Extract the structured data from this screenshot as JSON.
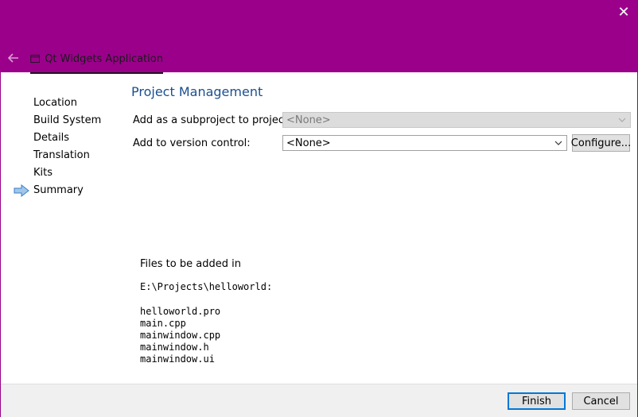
{
  "window": {
    "close_glyph": "✕",
    "header_tab_label": "Qt Widgets Application",
    "accent_color": "#9b008b"
  },
  "sidebar": {
    "steps": [
      {
        "label": "Location"
      },
      {
        "label": "Build System"
      },
      {
        "label": "Details"
      },
      {
        "label": "Translation"
      },
      {
        "label": "Kits"
      },
      {
        "label": "Summary",
        "current": true
      }
    ]
  },
  "page": {
    "title": "Project Management",
    "subproject_label": "Add as a subproject to project:",
    "subproject_value": "<None>",
    "vcs_label": "Add to version control:",
    "vcs_value": "<None>",
    "configure_label": "Configure...",
    "files_heading": "Files to be added in",
    "files_path": "E:\\Projects\\helloworld:",
    "files": [
      "helloworld.pro",
      "main.cpp",
      "mainwindow.cpp",
      "mainwindow.h",
      "mainwindow.ui"
    ]
  },
  "footer": {
    "finish_label": "Finish",
    "cancel_label": "Cancel"
  },
  "icons": {
    "close": "close-icon",
    "back": "back-arrow-icon",
    "tab": "window-icon",
    "current_step": "current-step-arrow-icon",
    "dropdown": "chevron-down-icon"
  }
}
